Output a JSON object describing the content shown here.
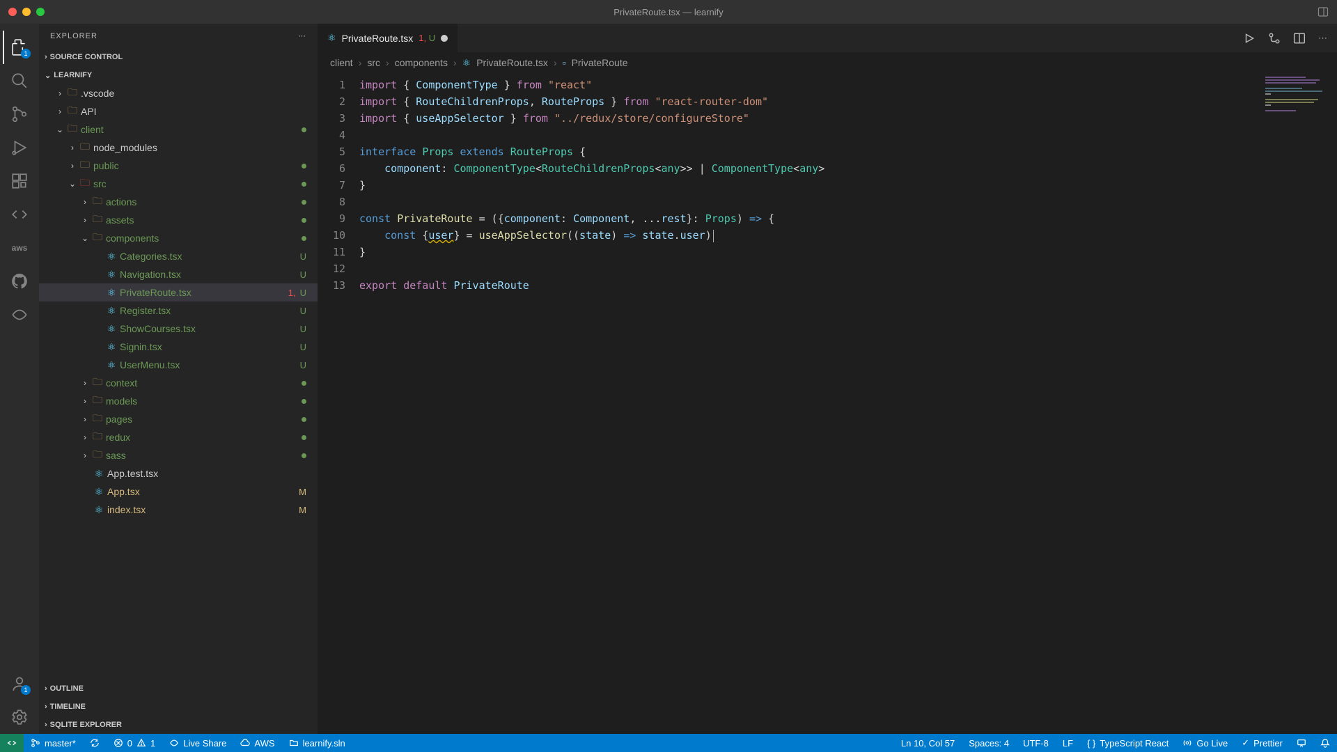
{
  "window": {
    "title": "PrivateRoute.tsx — learnify"
  },
  "sidebar": {
    "title": "EXPLORER",
    "sections": {
      "sourceControl": "SOURCE CONTROL",
      "workspace": "LEARNIFY",
      "outline": "OUTLINE",
      "timeline": "TIMELINE",
      "sqlite": "SQLITE EXPLORER"
    },
    "tree": {
      "vscode": ".vscode",
      "api": "API",
      "client": "client",
      "node_modules": "node_modules",
      "public": "public",
      "src": "src",
      "actions": "actions",
      "assets": "assets",
      "components": "components",
      "categories": "Categories.tsx",
      "navigation": "Navigation.tsx",
      "privateRoute": "PrivateRoute.tsx",
      "register": "Register.tsx",
      "showCourses": "ShowCourses.tsx",
      "signin": "Signin.tsx",
      "userMenu": "UserMenu.tsx",
      "context": "context",
      "models": "models",
      "pages": "pages",
      "redux": "redux",
      "sass": "sass",
      "appTest": "App.test.tsx",
      "app": "App.tsx",
      "index": "index.tsx"
    },
    "decor": {
      "U": "U",
      "M": "M",
      "oneU": "1, U"
    }
  },
  "tabs": {
    "active": {
      "name": "PrivateRoute.tsx",
      "badge": "1, U"
    }
  },
  "breadcrumbs": {
    "p0": "client",
    "p1": "src",
    "p2": "components",
    "p3": "PrivateRoute.tsx",
    "p4": "PrivateRoute"
  },
  "code": {
    "lines": [
      {
        "n": "1"
      },
      {
        "n": "2"
      },
      {
        "n": "3"
      },
      {
        "n": "4"
      },
      {
        "n": "5"
      },
      {
        "n": "6"
      },
      {
        "n": "7"
      },
      {
        "n": "8"
      },
      {
        "n": "9"
      },
      {
        "n": "10"
      },
      {
        "n": "11"
      },
      {
        "n": "12"
      },
      {
        "n": "13"
      }
    ],
    "tokens": {
      "import": "import",
      "from": "from",
      "interface": "interface",
      "extends": "extends",
      "const": "const",
      "export": "export",
      "default": "default",
      "ComponentType": "ComponentType",
      "RouteChildrenProps": "RouteChildrenProps",
      "RouteProps": "RouteProps",
      "useAppSelector": "useAppSelector",
      "Props": "Props",
      "componentKey": "component",
      "Component": "Component",
      "rest": "rest",
      "PrivateRoute": "PrivateRoute",
      "user": "user",
      "state": "state",
      "any": "any",
      "reactStr": "\"react\"",
      "rrdStr": "\"react-router-dom\"",
      "storeStr": "\"../redux/store/configureStore\""
    }
  },
  "status": {
    "branch": "master*",
    "sync": "",
    "errors": "0",
    "warnings": "1",
    "liveShare": "Live Share",
    "aws": "AWS",
    "solution": "learnify.sln",
    "cursor": "Ln 10, Col 57",
    "spaces": "Spaces: 4",
    "encoding": "UTF-8",
    "eol": "LF",
    "lang": "TypeScript React",
    "goLive": "Go Live",
    "prettier": "Prettier"
  },
  "badges": {
    "explorer": "1",
    "accounts": "1"
  }
}
